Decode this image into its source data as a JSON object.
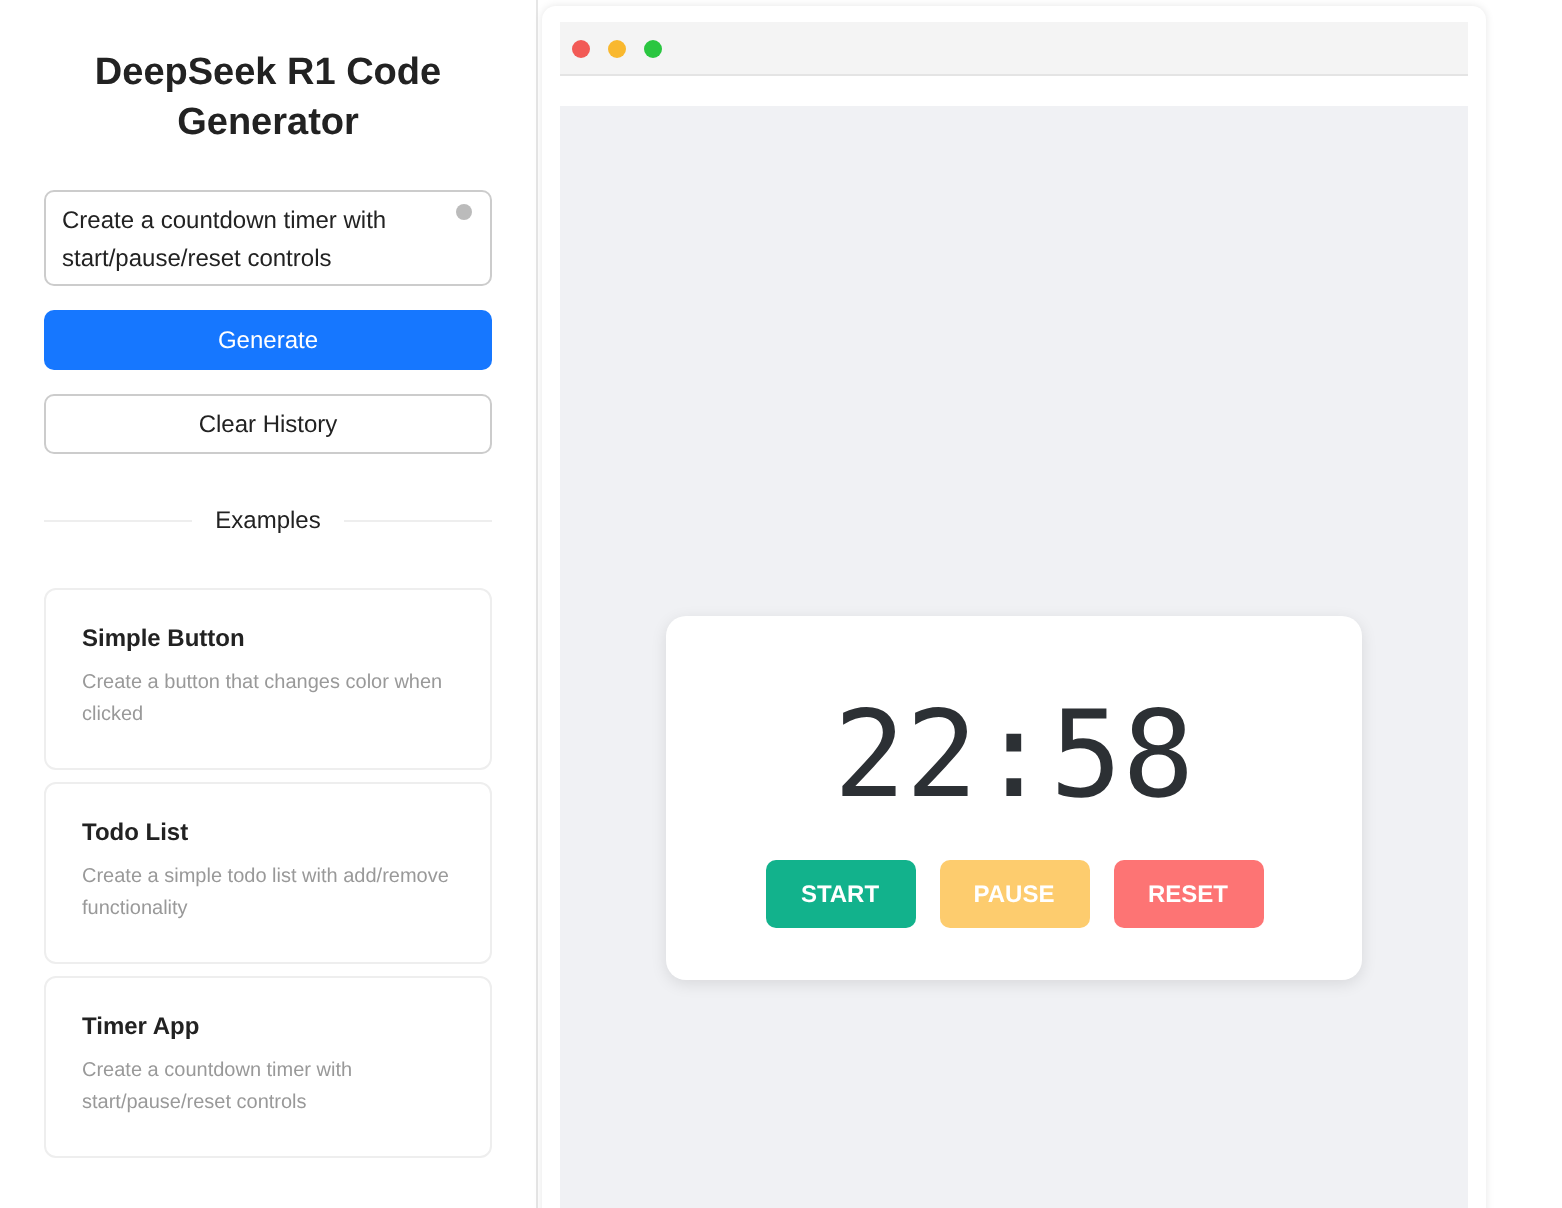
{
  "sidebar": {
    "title": "DeepSeek R1 Code Generator",
    "prompt": {
      "value": "Create a countdown timer with start/pause/reset controls"
    },
    "buttons": [
      {
        "label": "Generate",
        "kind": "primary"
      },
      {
        "label": "Clear History",
        "kind": "secondary"
      }
    ],
    "examples_heading": "Examples",
    "examples": [
      {
        "title": "Simple Button",
        "description": "Create a button that changes color when clicked"
      },
      {
        "title": "Todo List",
        "description": "Create a simple todo list with add/remove functionality"
      },
      {
        "title": "Timer App",
        "description": "Create a countdown timer with start/pause/reset controls"
      }
    ]
  },
  "preview": {
    "window_dots": [
      {
        "color": "#f25a56"
      },
      {
        "color": "#f9b82e"
      },
      {
        "color": "#2ac640"
      }
    ],
    "timer": {
      "time": "22:58",
      "buttons": [
        {
          "label": "START",
          "color": "#12b28c"
        },
        {
          "label": "PAUSE",
          "color": "#fdcc6e"
        },
        {
          "label": "RESET",
          "color": "#fd7474"
        }
      ]
    }
  }
}
